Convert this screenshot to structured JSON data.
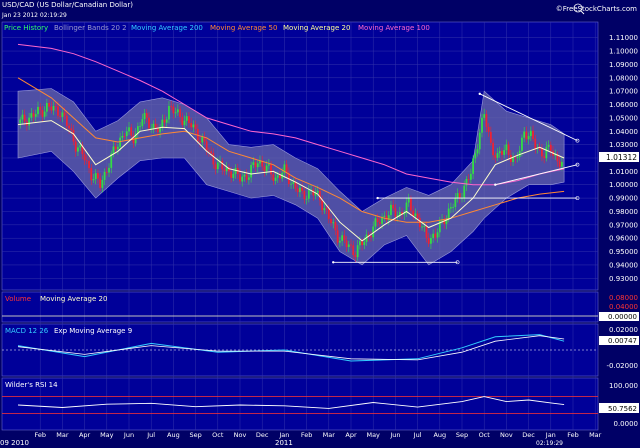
{
  "header": {
    "title": "USD/CAD (US Dollar/Canadian Dollar)",
    "timestamp": "Jan 23 2012 02:19:29",
    "brand": "©FreeStockCharts.com"
  },
  "legend": [
    {
      "label": "Price History",
      "color": "#33ff66"
    },
    {
      "label": "Bollinger Bands 20 2",
      "color": "#9999cc"
    },
    {
      "label": "Moving Average 200",
      "color": "#33ccff"
    },
    {
      "label": "Moving Average 50",
      "color": "#ff8833"
    },
    {
      "label": "Moving Average 20",
      "color": "#ffff99"
    },
    {
      "label": "Moving Average 100",
      "color": "#ff66cc"
    }
  ],
  "volume": {
    "title": "Volume",
    "ma_label": "Moving Average 20",
    "ticks": [
      "0.08000",
      "0.04000"
    ],
    "last": "0.00000"
  },
  "macd": {
    "title": "MACD 12 26",
    "ema_label": "Exp Moving Average 9",
    "ticks": [
      "0.02000",
      "-0.02000"
    ],
    "last": "0.00747"
  },
  "rsi": {
    "title": "Wilder's RSI 14",
    "ticks": [
      "100.000",
      "0.0000"
    ],
    "last": "50.7562"
  },
  "footer": {
    "year_2010": "09 2010",
    "year_2011": "2011",
    "time": "02:19:29"
  },
  "colors": {
    "background": "#000066",
    "up": "#33dd44",
    "down": "#ee2233",
    "band_fill": "#6a6aaa"
  },
  "chart_data": {
    "type": "candlestick",
    "price_ticks": [
      "1.11000",
      "1.10000",
      "1.09000",
      "1.08000",
      "1.07000",
      "1.06000",
      "1.05000",
      "1.04000",
      "1.03000",
      "1.02000",
      "1.01000",
      "1.00000",
      "0.99000",
      "0.98000",
      "0.97000",
      "0.96000",
      "0.95000",
      "0.94000",
      "0.93000"
    ],
    "ylim": [
      0.925,
      1.115
    ],
    "last_price": "1.01312",
    "x_start": 0,
    "months": [
      {
        "t": 1,
        "label": "Feb"
      },
      {
        "t": 2,
        "label": "Mar"
      },
      {
        "t": 3,
        "label": "Apr"
      },
      {
        "t": 4,
        "label": "May"
      },
      {
        "t": 5,
        "label": "Jun"
      },
      {
        "t": 6,
        "label": "Jul"
      },
      {
        "t": 7,
        "label": "Aug"
      },
      {
        "t": 8,
        "label": "Sep"
      },
      {
        "t": 9,
        "label": "Oct"
      },
      {
        "t": 10,
        "label": "Nov"
      },
      {
        "t": 11,
        "label": "Dec"
      },
      {
        "t": 12,
        "label": "Jan"
      },
      {
        "t": 13,
        "label": "Feb"
      },
      {
        "t": 14,
        "label": "Mar"
      },
      {
        "t": 15,
        "label": "Apr"
      },
      {
        "t": 16,
        "label": "May"
      },
      {
        "t": 17,
        "label": "Jun"
      },
      {
        "t": 18,
        "label": "Jul"
      },
      {
        "t": 19,
        "label": "Aug"
      },
      {
        "t": 20,
        "label": "Sep"
      },
      {
        "t": 21,
        "label": "Oct"
      },
      {
        "t": 22,
        "label": "Nov"
      },
      {
        "t": 23,
        "label": "Dec"
      },
      {
        "t": 24,
        "label": "Jan"
      },
      {
        "t": 25,
        "label": "Feb"
      },
      {
        "t": 26,
        "label": "Mar"
      }
    ],
    "close_series": [
      [
        0.0,
        1.046
      ],
      [
        0.7,
        1.052
      ],
      [
        1.3,
        1.058
      ],
      [
        1.9,
        1.055
      ],
      [
        2.3,
        1.042
      ],
      [
        2.6,
        1.03
      ],
      [
        3.0,
        1.02
      ],
      [
        3.3,
        1.008
      ],
      [
        3.7,
        1.0
      ],
      [
        4.0,
        1.012
      ],
      [
        4.4,
        1.028
      ],
      [
        4.8,
        1.04
      ],
      [
        5.2,
        1.035
      ],
      [
        5.6,
        1.05
      ],
      [
        6.0,
        1.045
      ],
      [
        6.4,
        1.04
      ],
      [
        6.8,
        1.058
      ],
      [
        7.2,
        1.052
      ],
      [
        7.6,
        1.048
      ],
      [
        8.0,
        1.04
      ],
      [
        8.4,
        1.03
      ],
      [
        8.8,
        1.018
      ],
      [
        9.2,
        1.012
      ],
      [
        9.6,
        1.01
      ],
      [
        10.0,
        1.005
      ],
      [
        10.4,
        1.008
      ],
      [
        10.8,
        1.018
      ],
      [
        11.2,
        1.012
      ],
      [
        11.6,
        1.005
      ],
      [
        12.0,
        1.01
      ],
      [
        12.4,
        1.0
      ],
      [
        12.8,
        0.992
      ],
      [
        13.2,
        0.995
      ],
      [
        13.6,
        0.99
      ],
      [
        14.0,
        0.975
      ],
      [
        14.4,
        0.962
      ],
      [
        14.8,
        0.955
      ],
      [
        15.2,
        0.95
      ],
      [
        15.6,
        0.958
      ],
      [
        16.0,
        0.968
      ],
      [
        16.4,
        0.975
      ],
      [
        16.8,
        0.98
      ],
      [
        17.2,
        0.978
      ],
      [
        17.6,
        0.985
      ],
      [
        18.0,
        0.975
      ],
      [
        18.4,
        0.96
      ],
      [
        18.8,
        0.962
      ],
      [
        19.2,
        0.975
      ],
      [
        19.6,
        0.985
      ],
      [
        20.0,
        0.995
      ],
      [
        20.4,
        1.008
      ],
      [
        20.8,
        1.04
      ],
      [
        21.0,
        1.052
      ],
      [
        21.3,
        1.03
      ],
      [
        21.6,
        1.02
      ],
      [
        22.0,
        1.028
      ],
      [
        22.4,
        1.015
      ],
      [
        22.8,
        1.04
      ],
      [
        23.1,
        1.035
      ],
      [
        23.4,
        1.028
      ],
      [
        23.7,
        1.022
      ],
      [
        24.0,
        1.028
      ],
      [
        24.3,
        1.018
      ],
      [
        24.6,
        1.013
      ]
    ],
    "bb_upper": [
      [
        0.0,
        1.07
      ],
      [
        1.5,
        1.072
      ],
      [
        2.5,
        1.062
      ],
      [
        3.5,
        1.04
      ],
      [
        4.5,
        1.048
      ],
      [
        5.5,
        1.062
      ],
      [
        6.5,
        1.065
      ],
      [
        7.5,
        1.06
      ],
      [
        8.5,
        1.05
      ],
      [
        9.5,
        1.03
      ],
      [
        10.5,
        1.028
      ],
      [
        11.5,
        1.03
      ],
      [
        12.5,
        1.02
      ],
      [
        13.5,
        1.012
      ],
      [
        14.5,
        0.995
      ],
      [
        15.5,
        0.98
      ],
      [
        16.5,
        0.99
      ],
      [
        17.5,
        0.998
      ],
      [
        18.5,
        0.992
      ],
      [
        19.5,
        1.0
      ],
      [
        20.5,
        1.018
      ],
      [
        21.0,
        1.07
      ],
      [
        22.0,
        1.055
      ],
      [
        23.0,
        1.05
      ],
      [
        24.0,
        1.045
      ],
      [
        24.6,
        1.038
      ]
    ],
    "bb_lower": [
      [
        0.0,
        1.02
      ],
      [
        1.5,
        1.025
      ],
      [
        2.5,
        1.01
      ],
      [
        3.5,
        0.99
      ],
      [
        4.5,
        1.005
      ],
      [
        5.5,
        1.018
      ],
      [
        6.5,
        1.02
      ],
      [
        7.5,
        1.02
      ],
      [
        8.5,
        1.0
      ],
      [
        9.5,
        0.995
      ],
      [
        10.5,
        0.99
      ],
      [
        11.5,
        0.992
      ],
      [
        12.5,
        0.985
      ],
      [
        13.5,
        0.975
      ],
      [
        14.5,
        0.95
      ],
      [
        15.5,
        0.94
      ],
      [
        16.5,
        0.955
      ],
      [
        17.5,
        0.962
      ],
      [
        18.5,
        0.94
      ],
      [
        19.5,
        0.95
      ],
      [
        20.5,
        0.965
      ],
      [
        21.0,
        0.975
      ],
      [
        22.0,
        0.99
      ],
      [
        23.0,
        1.0
      ],
      [
        24.0,
        1.0
      ],
      [
        24.6,
        1.002
      ]
    ],
    "ma20": [
      [
        0.0,
        1.045
      ],
      [
        1.5,
        1.048
      ],
      [
        2.5,
        1.038
      ],
      [
        3.5,
        1.015
      ],
      [
        4.5,
        1.025
      ],
      [
        5.5,
        1.04
      ],
      [
        6.5,
        1.043
      ],
      [
        7.5,
        1.042
      ],
      [
        8.5,
        1.025
      ],
      [
        9.5,
        1.012
      ],
      [
        10.5,
        1.008
      ],
      [
        11.5,
        1.01
      ],
      [
        12.5,
        1.002
      ],
      [
        13.5,
        0.993
      ],
      [
        14.5,
        0.972
      ],
      [
        15.5,
        0.958
      ],
      [
        16.5,
        0.97
      ],
      [
        17.5,
        0.98
      ],
      [
        18.5,
        0.968
      ],
      [
        19.5,
        0.975
      ],
      [
        20.5,
        0.99
      ],
      [
        21.5,
        1.015
      ],
      [
        22.5,
        1.022
      ],
      [
        23.5,
        1.028
      ],
      [
        24.6,
        1.02
      ]
    ],
    "ma50": [
      [
        0.0,
        1.08
      ],
      [
        1.5,
        1.065
      ],
      [
        2.5,
        1.05
      ],
      [
        3.5,
        1.035
      ],
      [
        4.5,
        1.032
      ],
      [
        5.5,
        1.035
      ],
      [
        6.5,
        1.038
      ],
      [
        7.5,
        1.04
      ],
      [
        8.5,
        1.035
      ],
      [
        9.5,
        1.025
      ],
      [
        10.5,
        1.02
      ],
      [
        11.5,
        1.015
      ],
      [
        12.5,
        1.005
      ],
      [
        13.5,
        0.998
      ],
      [
        14.5,
        0.99
      ],
      [
        15.5,
        0.98
      ],
      [
        16.5,
        0.975
      ],
      [
        17.5,
        0.972
      ],
      [
        18.5,
        0.972
      ],
      [
        19.5,
        0.975
      ],
      [
        20.5,
        0.98
      ],
      [
        21.5,
        0.985
      ],
      [
        22.5,
        0.99
      ],
      [
        23.5,
        0.993
      ],
      [
        24.6,
        0.995
      ]
    ],
    "ma100": [
      [
        0.0,
        1.105
      ],
      [
        1.5,
        1.102
      ],
      [
        2.5,
        1.098
      ],
      [
        3.5,
        1.092
      ],
      [
        4.5,
        1.085
      ],
      [
        5.5,
        1.078
      ],
      [
        6.5,
        1.07
      ],
      [
        7.5,
        1.06
      ],
      [
        8.5,
        1.05
      ],
      [
        9.5,
        1.045
      ],
      [
        10.5,
        1.04
      ],
      [
        11.5,
        1.038
      ],
      [
        12.5,
        1.035
      ],
      [
        13.5,
        1.03
      ],
      [
        14.5,
        1.025
      ],
      [
        15.5,
        1.02
      ],
      [
        16.5,
        1.015
      ],
      [
        17.5,
        1.008
      ],
      [
        18.5,
        1.005
      ],
      [
        19.5,
        1.002
      ],
      [
        20.5,
        1.0
      ],
      [
        21.5,
        1.0
      ],
      [
        22.5,
        1.003
      ],
      [
        23.5,
        1.008
      ],
      [
        24.6,
        1.012
      ]
    ],
    "trendlines": [
      [
        [
          20.8,
          1.068
        ],
        [
          25.2,
          1.033
        ]
      ],
      [
        [
          21.5,
          1.0
        ],
        [
          25.2,
          1.015
        ]
      ],
      [
        [
          16.2,
          0.99
        ],
        [
          25.2,
          0.99
        ]
      ],
      [
        [
          14.2,
          0.942
        ],
        [
          19.8,
          0.942
        ]
      ]
    ],
    "macd_line": [
      [
        0,
        0.004
      ],
      [
        3,
        -0.006
      ],
      [
        6,
        0.006
      ],
      [
        9,
        -0.002
      ],
      [
        12,
        0.0
      ],
      [
        15,
        -0.01
      ],
      [
        18,
        -0.008
      ],
      [
        20,
        0.002
      ],
      [
        21.5,
        0.012
      ],
      [
        23.5,
        0.014
      ],
      [
        24.6,
        0.008
      ]
    ],
    "macd_signal": [
      [
        0,
        0.003
      ],
      [
        3,
        -0.004
      ],
      [
        6,
        0.004
      ],
      [
        9,
        -0.001
      ],
      [
        12,
        -0.001
      ],
      [
        15,
        -0.008
      ],
      [
        18,
        -0.009
      ],
      [
        20,
        -0.002
      ],
      [
        21.5,
        0.008
      ],
      [
        23.5,
        0.013
      ],
      [
        24.6,
        0.01
      ]
    ],
    "rsi_line": [
      [
        0,
        50
      ],
      [
        2,
        44
      ],
      [
        4,
        52
      ],
      [
        6,
        54
      ],
      [
        8,
        46
      ],
      [
        10,
        50
      ],
      [
        12,
        48
      ],
      [
        14,
        42
      ],
      [
        16,
        56
      ],
      [
        18,
        45
      ],
      [
        20,
        58
      ],
      [
        21,
        70
      ],
      [
        22,
        58
      ],
      [
        23,
        62
      ],
      [
        24,
        55
      ],
      [
        24.6,
        51
      ]
    ]
  }
}
